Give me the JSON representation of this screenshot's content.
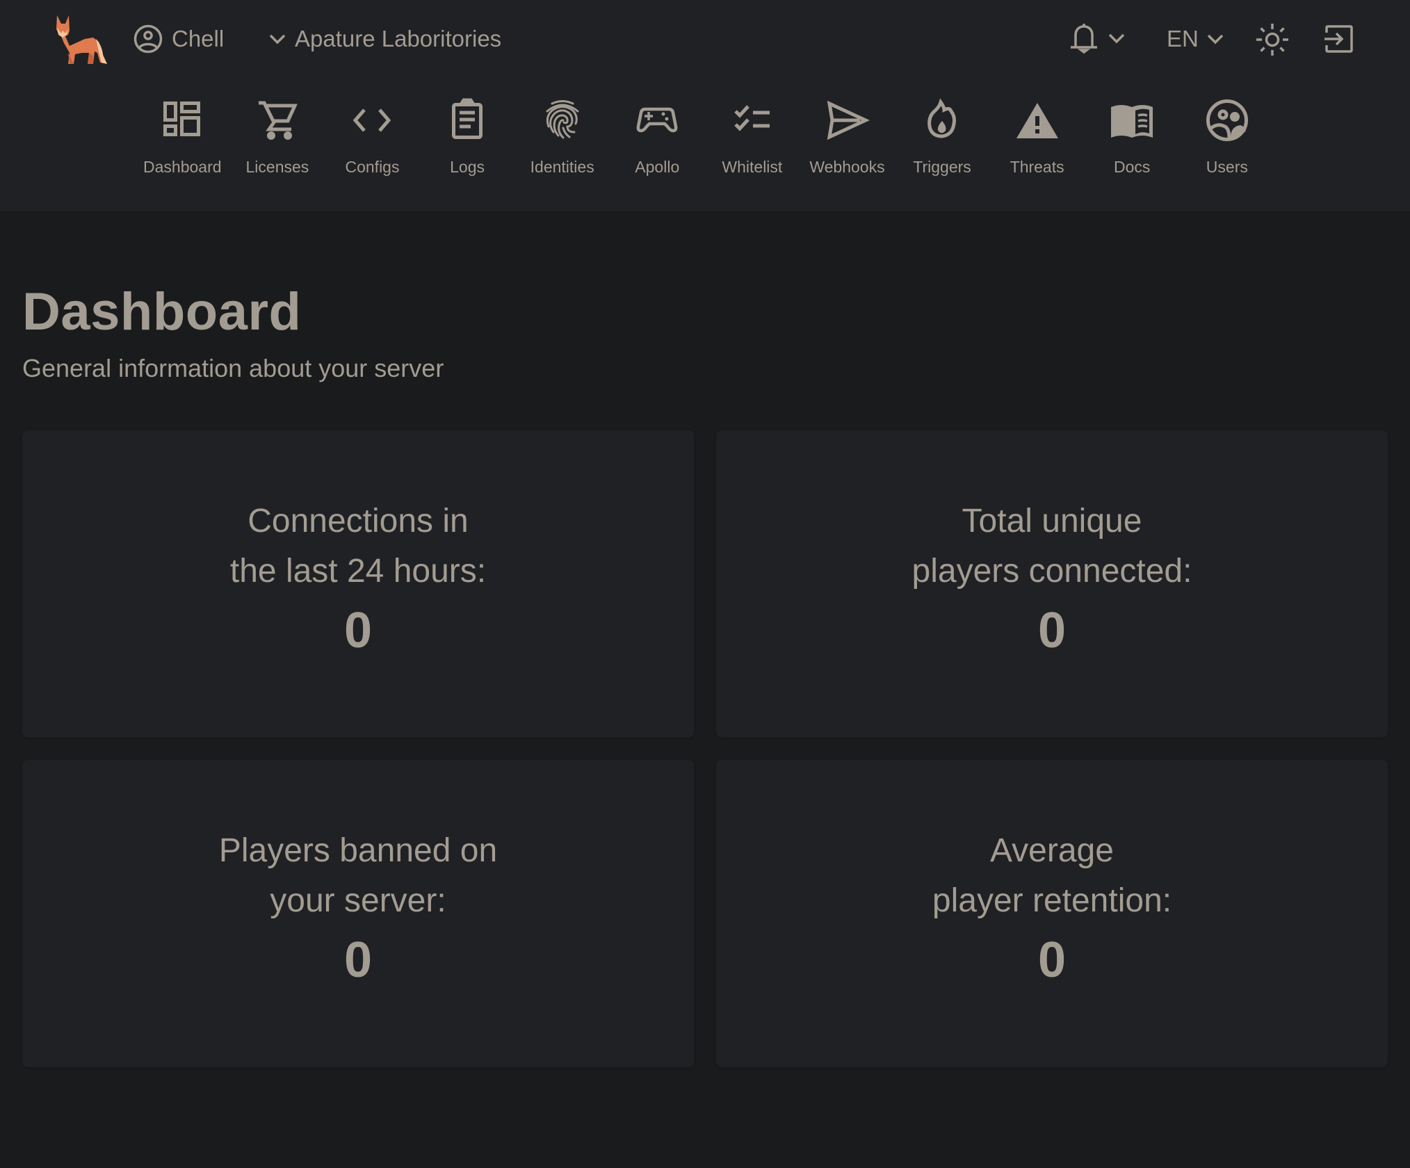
{
  "header": {
    "logo": "fox-logo",
    "user": {
      "icon": "user-circle-icon",
      "name": "Chell"
    },
    "organization": {
      "icon": "chevron-down-icon",
      "name": "Apature Laboritories"
    },
    "notifications": {
      "icon": "bell-icon",
      "dropdown_icon": "chevron-down-icon"
    },
    "language": {
      "value": "EN",
      "dropdown_icon": "chevron-down-icon"
    },
    "theme_toggle": {
      "icon": "sun-icon"
    },
    "logout": {
      "icon": "logout-icon"
    }
  },
  "nav": {
    "items": [
      {
        "label": "Dashboard",
        "icon": "dashboard-icon"
      },
      {
        "label": "Licenses",
        "icon": "cart-icon"
      },
      {
        "label": "Configs",
        "icon": "code-icon"
      },
      {
        "label": "Logs",
        "icon": "clipboard-icon"
      },
      {
        "label": "Identities",
        "icon": "fingerprint-icon"
      },
      {
        "label": "Apollo",
        "icon": "gamepad-icon"
      },
      {
        "label": "Whitelist",
        "icon": "checklist-icon"
      },
      {
        "label": "Webhooks",
        "icon": "send-icon"
      },
      {
        "label": "Triggers",
        "icon": "flame-icon"
      },
      {
        "label": "Threats",
        "icon": "warning-icon"
      },
      {
        "label": "Docs",
        "icon": "book-icon"
      },
      {
        "label": "Users",
        "icon": "users-icon"
      }
    ]
  },
  "page": {
    "title": "Dashboard",
    "subtitle": "General information about your server"
  },
  "stats": [
    {
      "label": "Connections in\nthe last 24 hours:",
      "value": "0"
    },
    {
      "label": "Total unique\nplayers connected:",
      "value": "0"
    },
    {
      "label": "Players banned on\nyour server:",
      "value": "0"
    },
    {
      "label": "Average\nplayer retention:",
      "value": "0"
    }
  ],
  "colors": {
    "header_bg": "#202124",
    "page_bg": "#1a1b1d",
    "card_bg": "#202124",
    "text": "#a39c92",
    "logo_orange": "#e07a4f",
    "logo_cream": "#f3c7a0"
  }
}
